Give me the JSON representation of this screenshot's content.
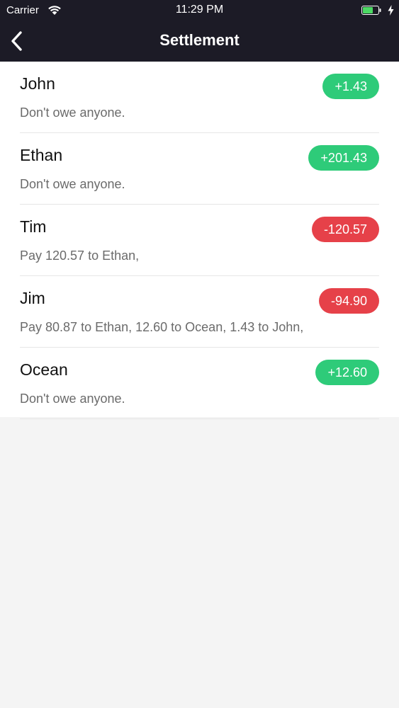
{
  "status_bar": {
    "carrier": "Carrier",
    "time": "11:29 PM"
  },
  "nav": {
    "title": "Settlement"
  },
  "colors": {
    "header_bg": "#1c1b26",
    "positive": "#2ecb79",
    "negative": "#e64149"
  },
  "settlements": [
    {
      "name": "John",
      "amount": "+1.43",
      "status": "positive",
      "description": "Don't owe anyone."
    },
    {
      "name": "Ethan",
      "amount": "+201.43",
      "status": "positive",
      "description": "Don't owe anyone."
    },
    {
      "name": "Tim",
      "amount": "-120.57",
      "status": "negative",
      "description": "Pay 120.57 to Ethan,"
    },
    {
      "name": "Jim",
      "amount": "-94.90",
      "status": "negative",
      "description": "Pay 80.87 to Ethan, 12.60 to Ocean, 1.43 to John,"
    },
    {
      "name": "Ocean",
      "amount": "+12.60",
      "status": "positive",
      "description": "Don't owe anyone."
    }
  ]
}
